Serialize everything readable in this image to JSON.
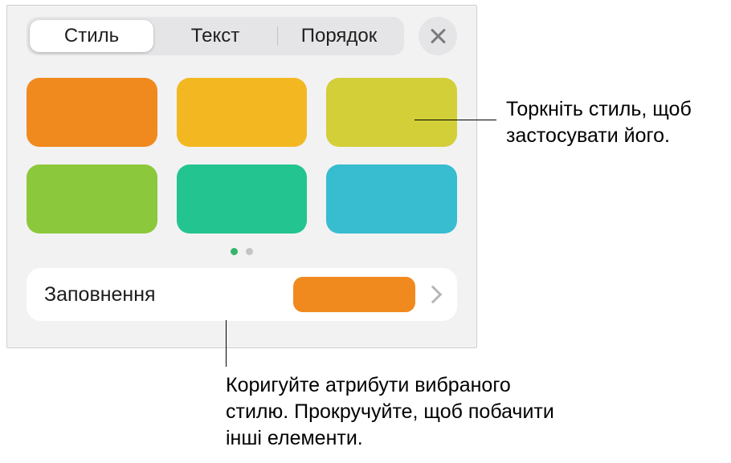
{
  "tabs": {
    "items": [
      {
        "label": "Стиль",
        "selected": true
      },
      {
        "label": "Текст",
        "selected": false
      },
      {
        "label": "Порядок",
        "selected": false
      }
    ]
  },
  "swatches": {
    "row1": [
      {
        "color": "#f08a1e"
      },
      {
        "color": "#f3b821"
      },
      {
        "color": "#d2cf38"
      }
    ],
    "row2": [
      {
        "color": "#8cc83c"
      },
      {
        "color": "#24c490"
      },
      {
        "color": "#37bcd0"
      }
    ]
  },
  "pager": {
    "count": 2,
    "active": 0
  },
  "fill": {
    "label": "Заповнення",
    "swatch_color": "#f08a1e"
  },
  "callouts": {
    "top": "Торкніть стиль, щоб застосувати його.",
    "bottom": "Коригуйте атрибути вибраного стилю. Прокручуйте, щоб побачити інші елементи."
  }
}
